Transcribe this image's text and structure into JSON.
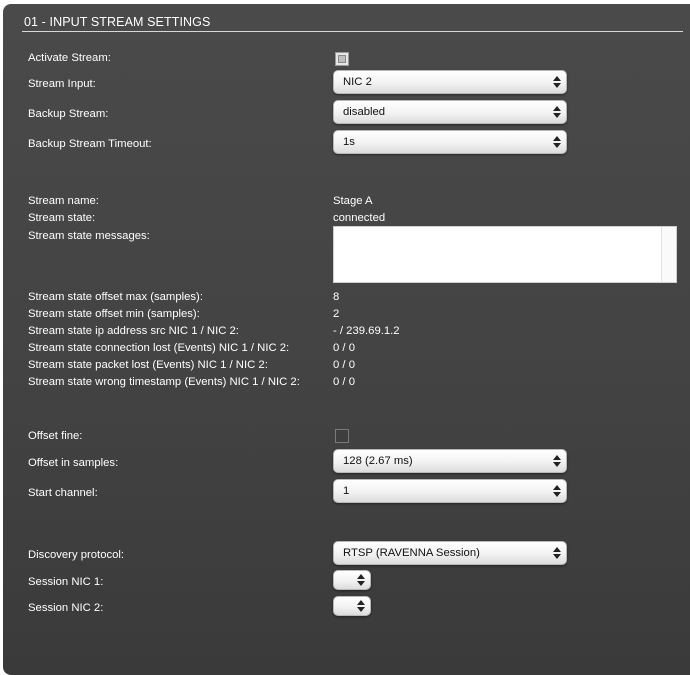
{
  "section": {
    "title": "01 - INPUT STREAM SETTINGS"
  },
  "settings": {
    "activate_stream": {
      "label": "Activate Stream:",
      "checked": true
    },
    "stream_input": {
      "label": "Stream Input:",
      "value": "NIC 2"
    },
    "backup_stream": {
      "label": "Backup Stream:",
      "value": "disabled"
    },
    "backup_stream_timeout": {
      "label": "Backup Stream Timeout:",
      "value": "1s"
    }
  },
  "status": {
    "stream_name": {
      "label": "Stream name:",
      "value": "Stage A"
    },
    "stream_state": {
      "label": "Stream state:",
      "value": "connected"
    },
    "stream_state_messages": {
      "label": "Stream state messages:",
      "value": ""
    },
    "offset_max": {
      "label": "Stream state offset max (samples):",
      "value": "8"
    },
    "offset_min": {
      "label": "Stream state offset min (samples):",
      "value": "2"
    },
    "ip_src": {
      "label": "Stream state ip address src NIC 1 / NIC 2:",
      "value": "- / 239.69.1.2"
    },
    "connection_lost": {
      "label": "Stream state connection lost (Events) NIC 1 / NIC 2:",
      "value": "0 / 0"
    },
    "packet_lost": {
      "label": "Stream state packet lost (Events) NIC 1 / NIC 2:",
      "value": "0 / 0"
    },
    "wrong_timestamp": {
      "label": "Stream state wrong timestamp (Events) NIC 1 / NIC 2:",
      "value": "0 / 0"
    }
  },
  "offset": {
    "offset_fine": {
      "label": "Offset fine:",
      "checked": false
    },
    "offset_in_samples": {
      "label": "Offset in samples:",
      "value": "128 (2.67 ms)"
    },
    "start_channel": {
      "label": "Start channel:",
      "value": "1"
    }
  },
  "discovery": {
    "protocol": {
      "label": "Discovery protocol:",
      "value": "RTSP (RAVENNA Session)"
    },
    "session_nic1": {
      "label": "Session NIC 1:",
      "value": ""
    },
    "session_nic2": {
      "label": "Session NIC 2:",
      "value": ""
    }
  },
  "colors": {
    "panel_background": "#454545",
    "text": "#ffffff",
    "select_text": "#111111"
  }
}
